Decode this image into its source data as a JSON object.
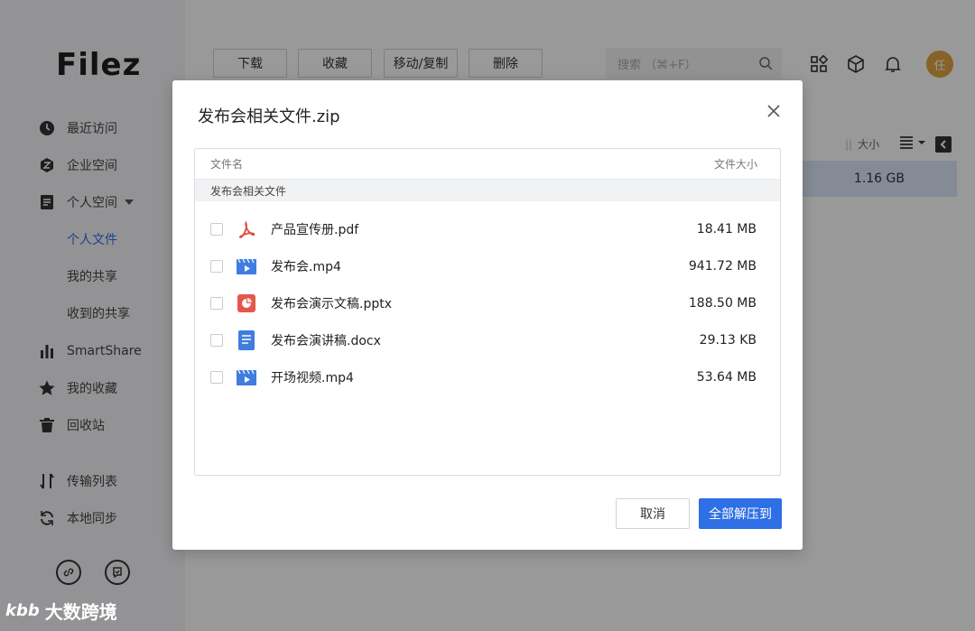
{
  "app": {
    "logo": "Filez",
    "sidebar": {
      "items": [
        {
          "label": "最近访问",
          "icon": "clock-icon"
        },
        {
          "label": "企业空间",
          "icon": "enterprise-icon"
        },
        {
          "label": "个人空间",
          "icon": "personal-space-icon"
        },
        {
          "label": "SmartShare",
          "icon": "bar-chart-icon"
        },
        {
          "label": "我的收藏",
          "icon": "star-icon"
        },
        {
          "label": "回收站",
          "icon": "trash-icon"
        },
        {
          "label": "传输列表",
          "icon": "transfer-icon"
        },
        {
          "label": "本地同步",
          "icon": "sync-icon"
        }
      ],
      "subitems": [
        {
          "label": "个人文件"
        },
        {
          "label": "我的共享"
        },
        {
          "label": "收到的共享"
        }
      ]
    },
    "toolbar": {
      "download": "下载",
      "favorite": "收藏",
      "move_copy": "移动/复制",
      "delete": "删除"
    },
    "search": {
      "placeholder": "搜索  （⌘+F）"
    },
    "avatar_initial": "任",
    "list": {
      "size_header": "大小",
      "selected_row_size": "1.16 GB"
    }
  },
  "dialog": {
    "title": "发布会相关文件.zip",
    "panel": {
      "col_name": "文件名",
      "col_size": "文件大小",
      "folder": "发布会相关文件"
    },
    "files": [
      {
        "name": "产品宣传册.pdf",
        "size": "18.41 MB",
        "icon": "pdf-icon"
      },
      {
        "name": "发布会.mp4",
        "size": "941.72 MB",
        "icon": "video-icon"
      },
      {
        "name": "发布会演示文稿.pptx",
        "size": "188.50 MB",
        "icon": "pptx-icon"
      },
      {
        "name": "发布会演讲稿.docx",
        "size": "29.13 KB",
        "icon": "docx-icon"
      },
      {
        "name": "开场视频.mp4",
        "size": "53.64 MB",
        "icon": "video-icon"
      }
    ],
    "cancel": "取消",
    "extract_all": "全部解压到"
  },
  "watermark": {
    "logo": "kbb",
    "text": "大数跨境"
  }
}
